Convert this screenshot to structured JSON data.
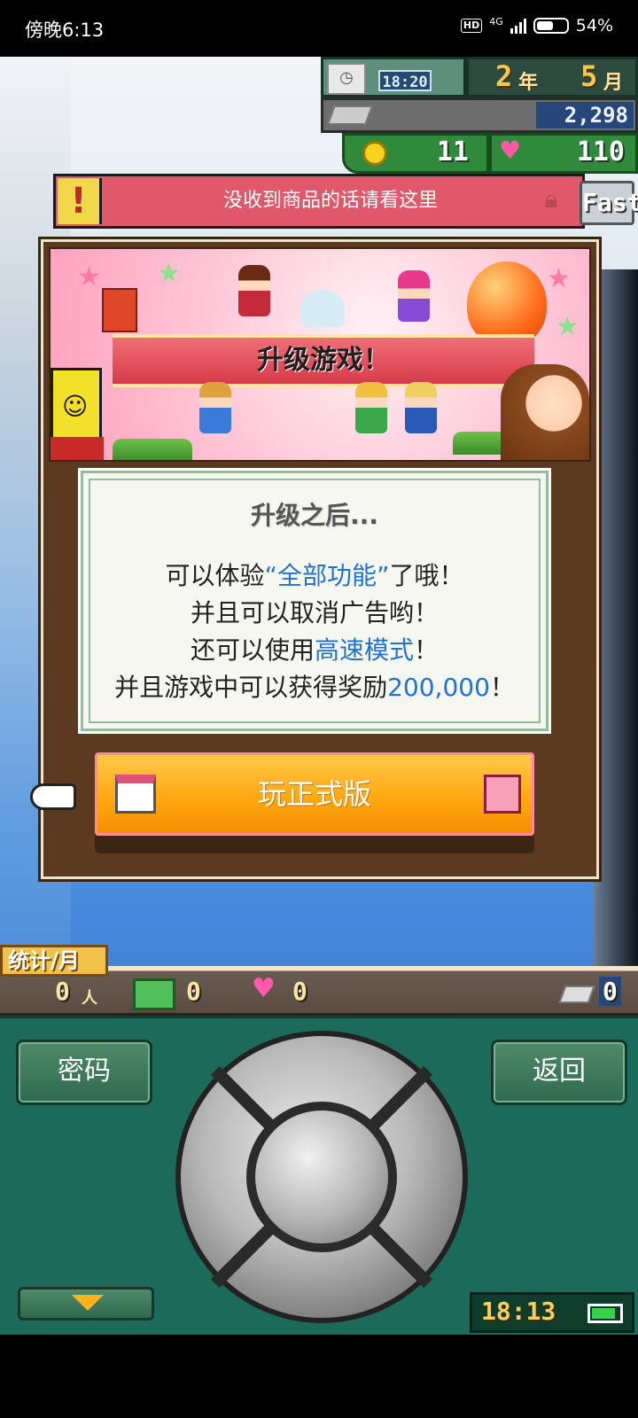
{
  "status_bar": {
    "time": "傍晚6:13",
    "hd": "HD",
    "network": "4G",
    "battery": "54%"
  },
  "hud": {
    "clock_time": "18:20",
    "year_num": "2",
    "year_unit": "年",
    "month_num": "5",
    "month_unit": "月",
    "money": "2,298",
    "coins": "11",
    "hearts": "110"
  },
  "notice": {
    "text": "没收到商品的话请看这里",
    "fast_label": "Fast"
  },
  "dialog": {
    "banner_title": "升级游戏！",
    "box_title": "升级之后...",
    "lines": [
      {
        "pre": "可以体验",
        "hl": "“全部功能”",
        "post": "了哦！"
      },
      {
        "pre": "并且可以取消广告哟！",
        "hl": "",
        "post": ""
      },
      {
        "pre": "还可以使用",
        "hl": "高速模式",
        "post": "！"
      },
      {
        "pre": "并且游戏中可以获得奖励",
        "hl": "200,000",
        "post": "！"
      }
    ],
    "play_button": "玩正式版"
  },
  "stats": {
    "tab_label": "统计/月",
    "people": "0",
    "people_unit": "人",
    "gifts": "0",
    "hearts": "0",
    "tickets": "0"
  },
  "controller": {
    "password_button": "密码",
    "back_button": "返回",
    "time": "18:13"
  },
  "colors": {
    "accent_blue": "#1f73d1",
    "play_orange": "#ffa812",
    "controller_green": "#1c6a5a"
  }
}
